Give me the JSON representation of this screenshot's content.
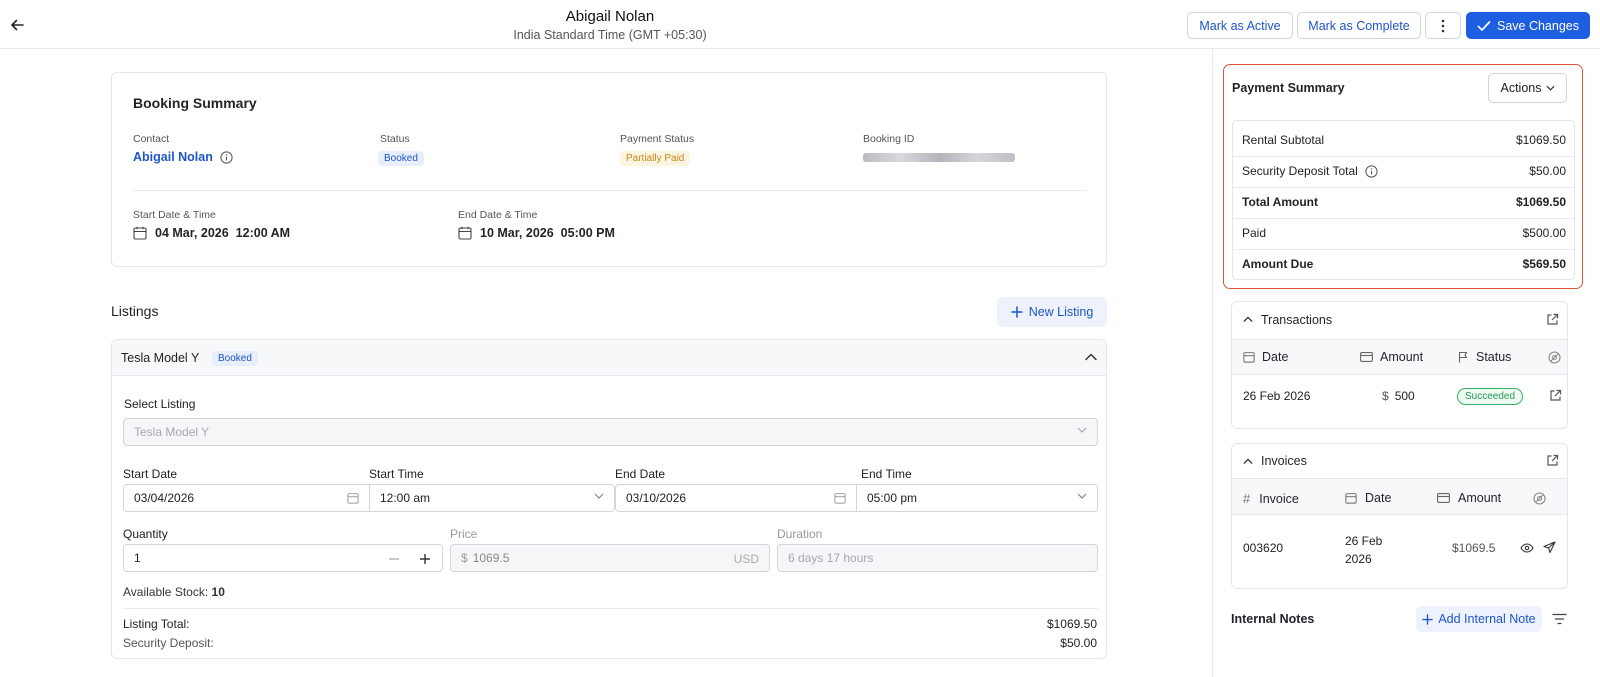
{
  "header": {
    "title": "Abigail Nolan",
    "subtitle": "India Standard Time (GMT +05:30)",
    "mark_active": "Mark as Active",
    "mark_complete": "Mark as Complete",
    "save_changes": "Save Changes"
  },
  "booking": {
    "heading": "Booking Summary",
    "contact_label": "Contact",
    "contact_value": "Abigail Nolan",
    "status_label": "Status",
    "status_value": "Booked",
    "payment_status_label": "Payment Status",
    "payment_status_value": "Partially Paid",
    "booking_id_label": "Booking ID",
    "start_label": "Start Date & Time",
    "start_date": "04 Mar, 2026",
    "start_time": "12:00 AM",
    "end_label": "End Date & Time",
    "end_date": "10 Mar, 2026",
    "end_time": "05:00 PM"
  },
  "listings": {
    "heading": "Listings",
    "new_listing": "New Listing",
    "item_name": "Tesla Model Y",
    "item_status": "Booked",
    "select_label": "Select Listing",
    "select_placeholder": "Tesla Model Y",
    "start_date_label": "Start Date",
    "start_date_value": "03/04/2026",
    "start_time_label": "Start Time",
    "start_time_value": "12:00 am",
    "end_date_label": "End Date",
    "end_date_value": "03/10/2026",
    "end_time_label": "End Time",
    "end_time_value": "05:00 pm",
    "quantity_label": "Quantity",
    "quantity_value": "1",
    "price_label": "Price",
    "price_currency_symbol": "$",
    "price_value": "1069.5",
    "price_currency": "USD",
    "duration_label": "Duration",
    "duration_value": "6 days 17 hours",
    "stock_label": "Available Stock:",
    "stock_value": "10",
    "listing_total_label": "Listing Total:",
    "listing_total_value": "$1069.50",
    "deposit_label": "Security Deposit:",
    "deposit_value": "$50.00"
  },
  "payment": {
    "heading": "Payment Summary",
    "actions": "Actions",
    "rows": [
      {
        "label": "Rental Subtotal",
        "value": "$1069.50"
      },
      {
        "label": "Security Deposit Total",
        "value": "$50.00"
      },
      {
        "label": "Total Amount",
        "value": "$1069.50"
      },
      {
        "label": "Paid",
        "value": "$500.00"
      },
      {
        "label": "Amount Due",
        "value": "$569.50"
      }
    ]
  },
  "transactions": {
    "heading": "Transactions",
    "col_date": "Date",
    "col_amount": "Amount",
    "col_status": "Status",
    "row_date": "26 Feb 2026",
    "row_amount_symbol": "$",
    "row_amount": "500",
    "row_status": "Succeeded"
  },
  "invoices": {
    "heading": "Invoices",
    "col_invoice": "Invoice",
    "col_date": "Date",
    "col_amount": "Amount",
    "row_invoice": "003620",
    "row_date_line1": "26 Feb",
    "row_date_line2": "2026",
    "row_amount": "$1069.5"
  },
  "notes": {
    "heading": "Internal Notes",
    "add": "Add Internal Note"
  },
  "colors": {
    "accent": "#1d5fe0",
    "highlight_border": "#e0533f",
    "success": "#239a55",
    "warning": "#c78a1a"
  }
}
